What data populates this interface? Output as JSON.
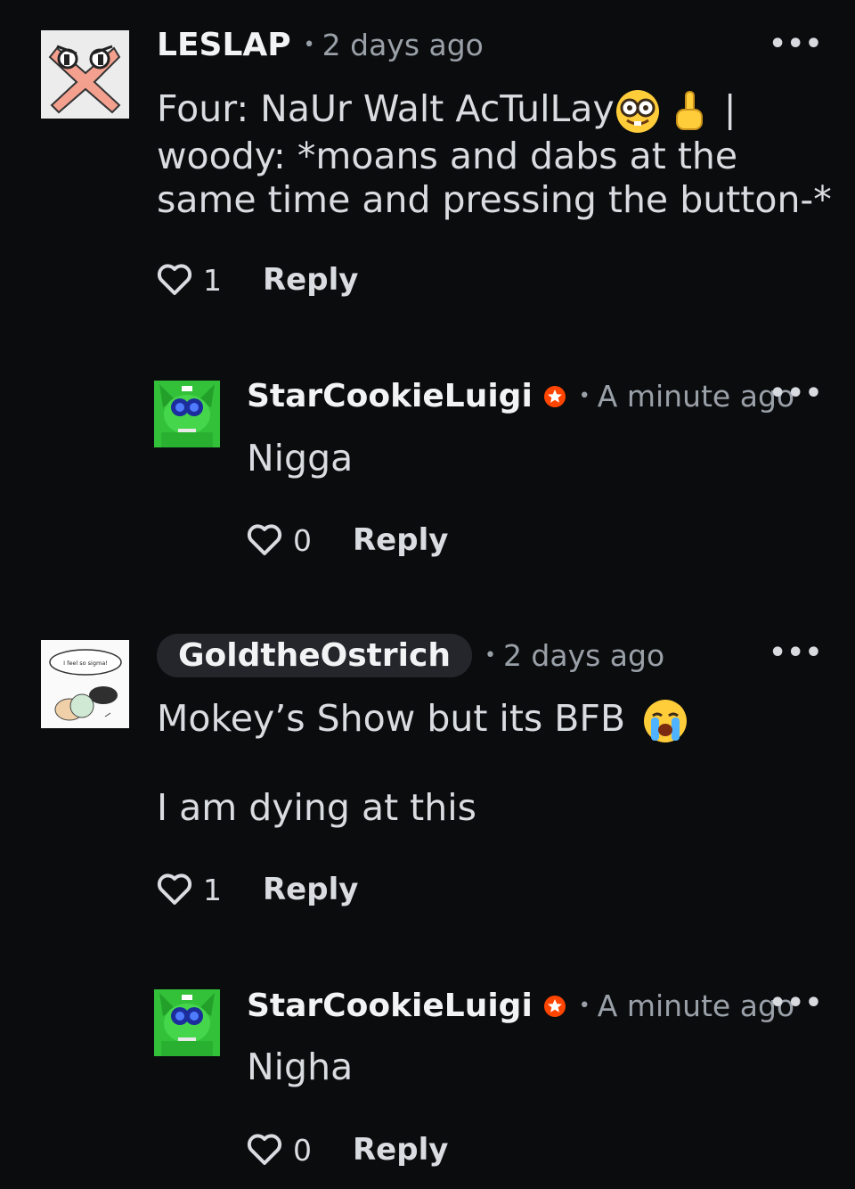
{
  "comments": [
    {
      "username": "LESLAP",
      "time": "2 days ago",
      "body": "Four: NaUr Walt AcTulLay",
      "body_tail": " | woody: *moans and dabs at the same time and pressing the button-*",
      "likes": "1",
      "reply": "Reply",
      "more": "•••",
      "avatar": "x-face-avatar"
    },
    {
      "username": "StarCookieLuigi",
      "time": "A minute ago",
      "body": "Nigga",
      "likes": "0",
      "reply": "Reply",
      "more": "•••",
      "avatar": "green-creature-avatar",
      "badge": "star-badge-icon"
    },
    {
      "username": "GoldtheOstrich",
      "time": "2 days ago",
      "body": "Mokey’s Show but its BFB",
      "body2": "I am dying at this",
      "likes": "1",
      "reply": "Reply",
      "more": "•••",
      "avatar": "sketch-avatar",
      "avatar_caption": "I feel so sigma!"
    },
    {
      "username": "StarCookieLuigi",
      "time": "A minute ago",
      "body": "Nigha",
      "likes": "0",
      "reply": "Reply",
      "more": "•••",
      "avatar": "green-creature-avatar",
      "badge": "star-badge-icon"
    }
  ],
  "separator": "•",
  "colors": {
    "background": "#0b0c0e",
    "badge": "#ff4500",
    "muted": "#9aa0a8"
  }
}
